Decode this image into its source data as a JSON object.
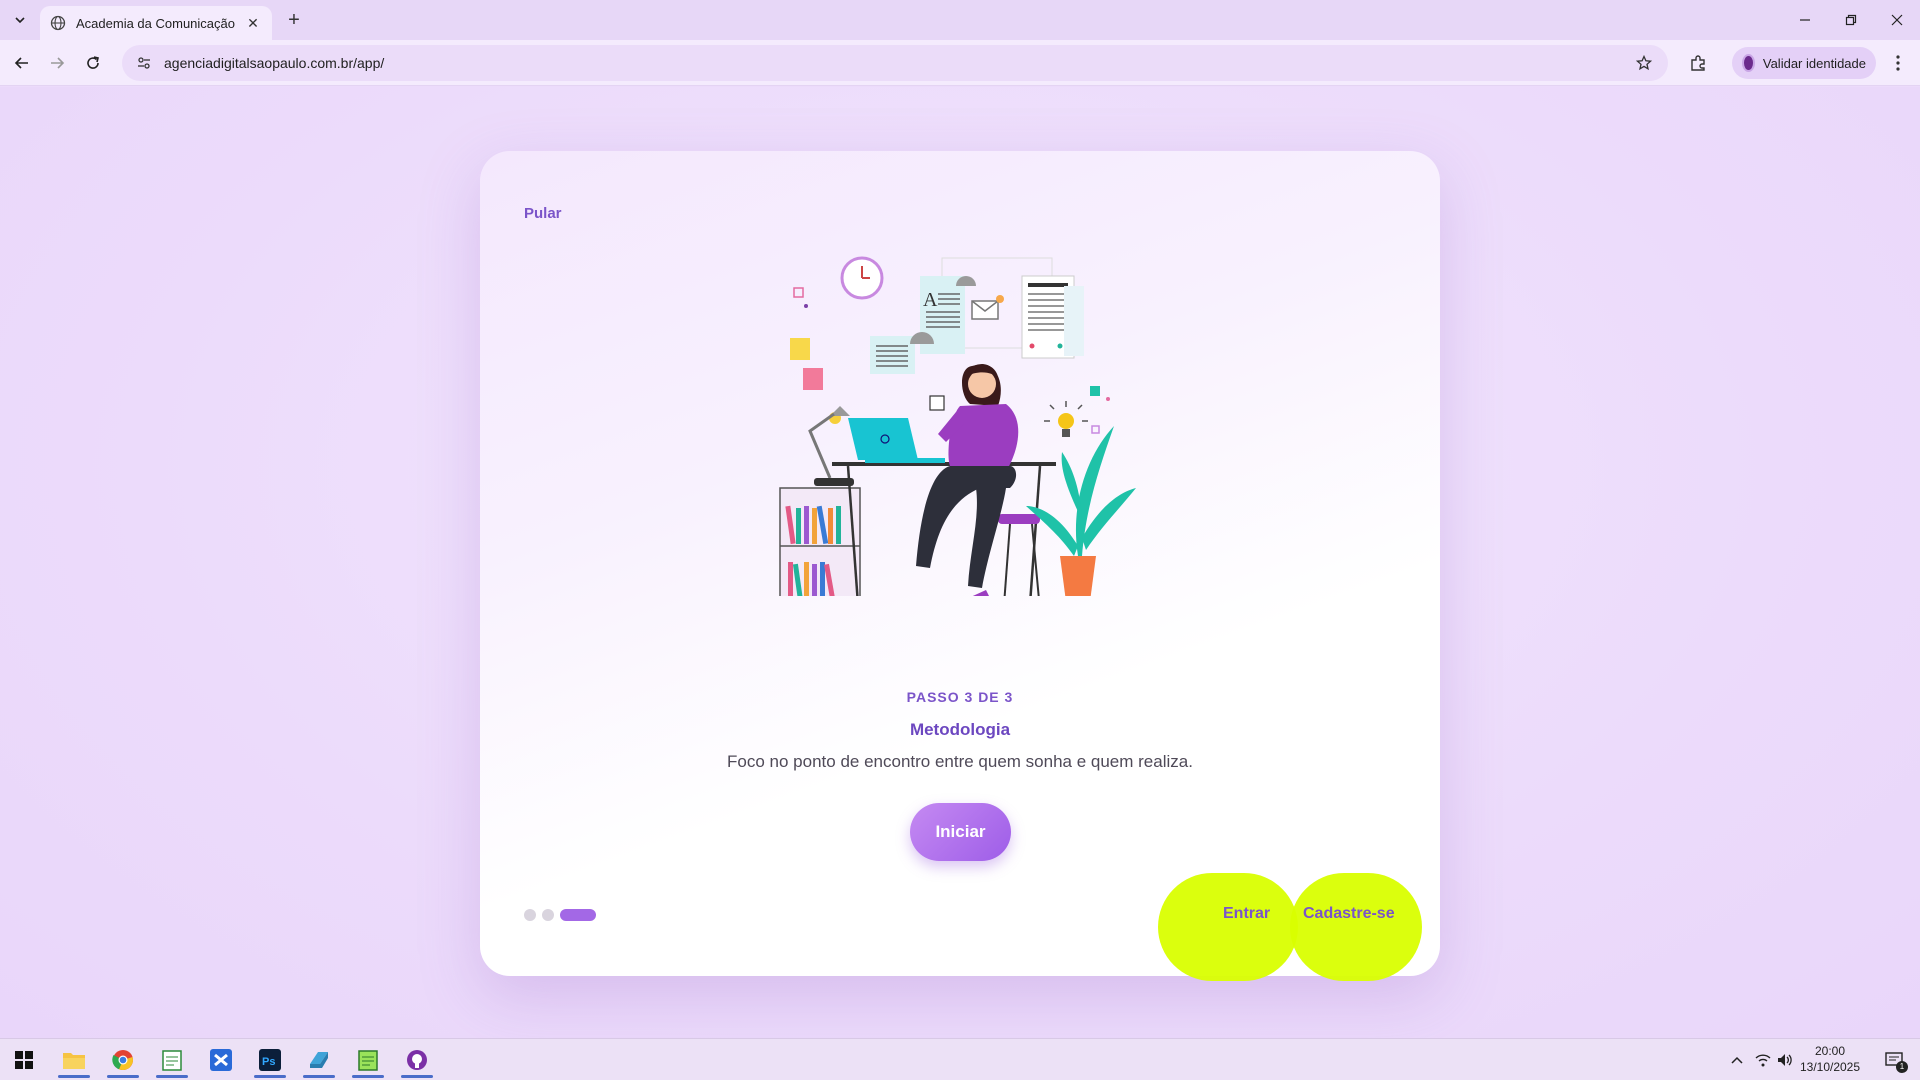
{
  "browser": {
    "tab_title": "Academia da Comunicação",
    "url": "agenciadigitalsaopaulo.com.br/app/",
    "profile_label": "Validar identidade"
  },
  "onboarding": {
    "skip_label": "Pular",
    "step_label": "PASSO 3 DE 3",
    "heading": "Metodologia",
    "description": "Foco no ponto de encontro entre quem sonha e quem realiza.",
    "start_label": "Iniciar",
    "current_step": 3,
    "total_steps": 3,
    "login_label": "Entrar",
    "signup_label": "Cadastre-se"
  },
  "colors": {
    "accent": "#7b54c9",
    "button": "#a368e6",
    "highlight": "#d9ff00",
    "background": "#ecdbfb"
  },
  "taskbar": {
    "apps": [
      "start-icon",
      "file-explorer-icon",
      "chrome-icon",
      "notepad-icon",
      "visual-studio-icon",
      "photoshop-icon",
      "edge-icon",
      "editor-icon",
      "github-icon"
    ],
    "time": "20:00",
    "date": "13/10/2025",
    "notification_count": "1"
  }
}
